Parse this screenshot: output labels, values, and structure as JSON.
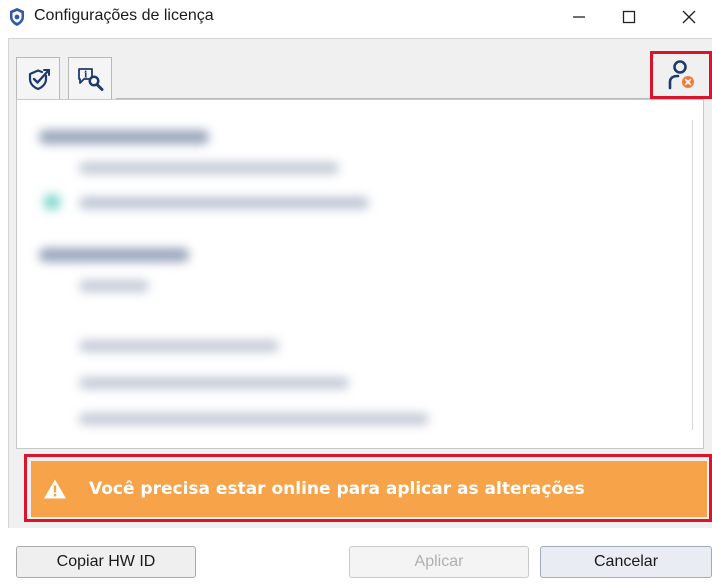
{
  "window": {
    "title": "Configurações de licença",
    "icon": "shield-icon"
  },
  "window_controls": {
    "minimize": "minimize-icon",
    "maximize": "maximize-icon",
    "close": "close-icon"
  },
  "toolbar": {
    "tabs": [
      {
        "icon": "shield-check-icon"
      },
      {
        "icon": "info-search-icon"
      }
    ],
    "user_button_icon": "user-offline-icon"
  },
  "content": {
    "state": "blurred"
  },
  "warning": {
    "text": "Você precisa estar online para aplicar as alterações",
    "icon": "warning-icon",
    "color": "#f7a34a"
  },
  "buttons": {
    "copy_hw_id": "Copiar HW ID",
    "apply": "Aplicar",
    "cancel": "Cancelar"
  },
  "colors": {
    "highlight": "#d9142b",
    "icon_blue": "#1d3a6e",
    "offline_badge": "#ef7b3a"
  }
}
